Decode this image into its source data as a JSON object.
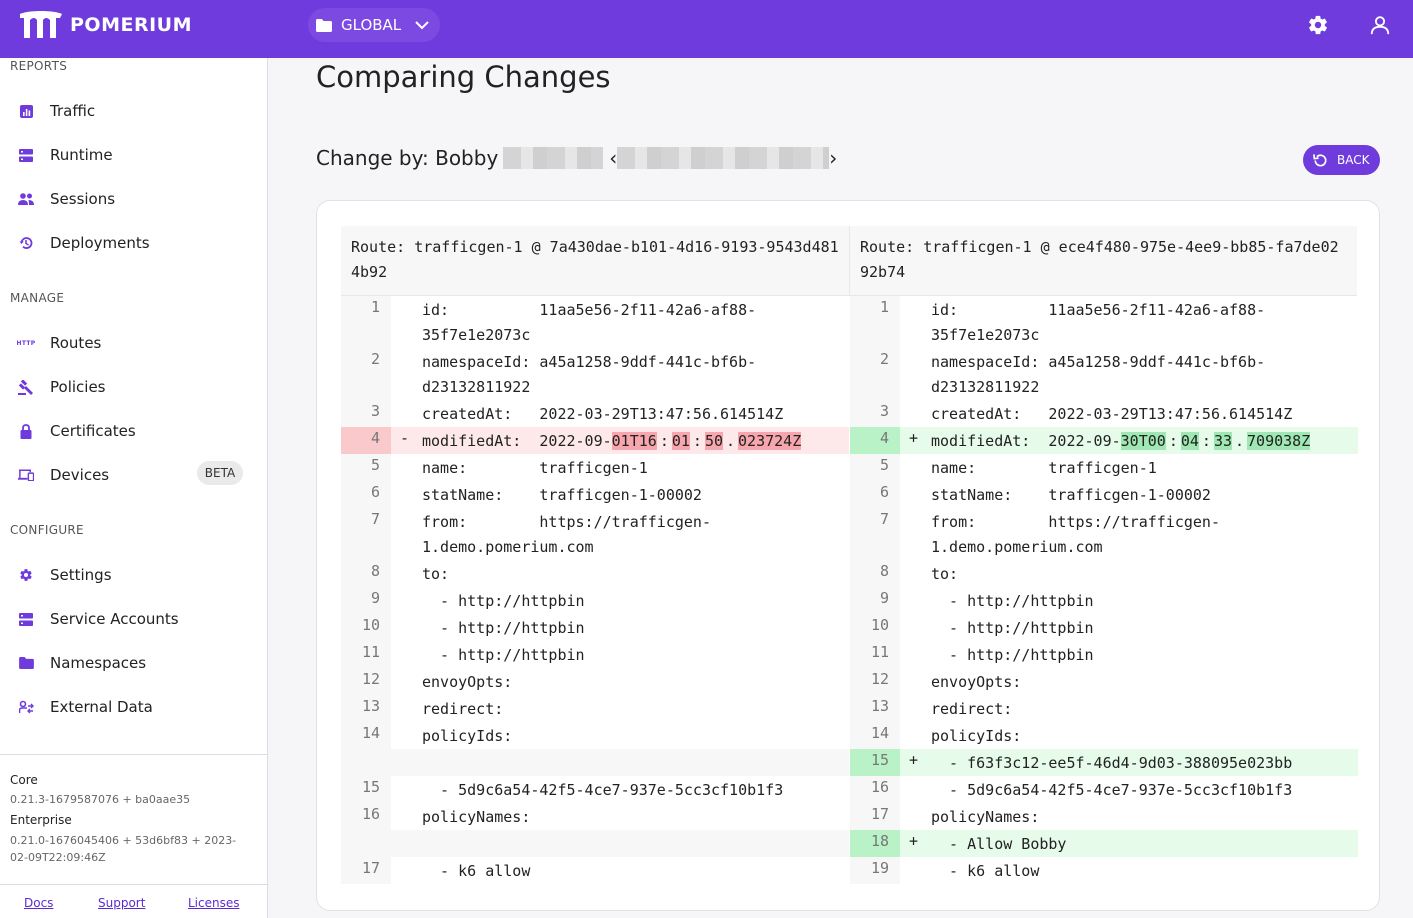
{
  "brand": {
    "name": "POMERIUM"
  },
  "header": {
    "namespace": "GLOBAL"
  },
  "sidebar": {
    "sections": [
      {
        "title": "REPORTS",
        "items": [
          {
            "label": "Traffic",
            "icon": "bar-chart-icon"
          },
          {
            "label": "Runtime",
            "icon": "storage-icon"
          },
          {
            "label": "Sessions",
            "icon": "people-icon"
          },
          {
            "label": "Deployments",
            "icon": "history-icon"
          }
        ]
      },
      {
        "title": "MANAGE",
        "items": [
          {
            "label": "Routes",
            "icon": "http-icon"
          },
          {
            "label": "Policies",
            "icon": "gavel-icon"
          },
          {
            "label": "Certificates",
            "icon": "lock-icon"
          },
          {
            "label": "Devices",
            "icon": "devices-icon",
            "badge": "BETA"
          }
        ]
      },
      {
        "title": "CONFIGURE",
        "items": [
          {
            "label": "Settings",
            "icon": "gear-icon"
          },
          {
            "label": "Service Accounts",
            "icon": "storage-icon"
          },
          {
            "label": "Namespaces",
            "icon": "folder-icon"
          },
          {
            "label": "External Data",
            "icon": "external-data-icon"
          }
        ]
      }
    ],
    "version": {
      "core_label": "Core",
      "core_value": "0.21.3-1679587076 + ba0aae35",
      "enterprise_label": "Enterprise",
      "enterprise_value": "0.21.0-1676045406 + 53d6bf83 + 2023-02-09T22:09:46Z"
    },
    "footer": {
      "docs": "Docs",
      "support": "Support",
      "licenses": "Licenses"
    }
  },
  "main": {
    "title": "Comparing Changes",
    "change_by": "Change by: Bobby",
    "back_label": "BACK",
    "left_header": "Route: trafficgen-1 @ 7a430dae-b101-4d16-9193-9543d4814b92",
    "right_header": "Route: trafficgen-1 @ ece4f480-975e-4ee9-bb85-fa7de0292b74",
    "left_lines": [
      {
        "n": "1",
        "text": "id:          11aa5e56-2f11-42a6-af88-\n35f7e1e2073c"
      },
      {
        "n": "2",
        "text": "namespaceId: a45a1258-9ddf-441c-bf6b-\nd23132811922"
      },
      {
        "n": "3",
        "text": "createdAt:   2022-03-29T13:47:56.614514Z"
      },
      {
        "n": "4",
        "type": "del",
        "mark": "-",
        "pre": "modifiedAt:  2022-09-",
        "parts": [
          "01T16",
          ":",
          "01",
          ":",
          "50",
          ".",
          "023724Z"
        ]
      },
      {
        "n": "5",
        "text": "name:        trafficgen-1"
      },
      {
        "n": "6",
        "text": "statName:    trafficgen-1-00002"
      },
      {
        "n": "7",
        "text": "from:        https://trafficgen-\n1.demo.pomerium.com"
      },
      {
        "n": "8",
        "text": "to:"
      },
      {
        "n": "9",
        "text": "  - http://httpbin"
      },
      {
        "n": "10",
        "text": "  - http://httpbin"
      },
      {
        "n": "11",
        "text": "  - http://httpbin"
      },
      {
        "n": "12",
        "text": "envoyOpts:"
      },
      {
        "n": "13",
        "text": "redirect:"
      },
      {
        "n": "14",
        "text": "policyIds:"
      },
      {
        "n": "",
        "type": "empty",
        "text": ""
      },
      {
        "n": "15",
        "text": "  - 5d9c6a54-42f5-4ce7-937e-5cc3cf10b1f3"
      },
      {
        "n": "16",
        "text": "policyNames:"
      },
      {
        "n": "",
        "type": "empty",
        "text": ""
      },
      {
        "n": "17",
        "text": "  - k6 allow"
      }
    ],
    "right_lines": [
      {
        "n": "1",
        "text": "id:          11aa5e56-2f11-42a6-af88-\n35f7e1e2073c"
      },
      {
        "n": "2",
        "text": "namespaceId: a45a1258-9ddf-441c-bf6b-\nd23132811922"
      },
      {
        "n": "3",
        "text": "createdAt:   2022-03-29T13:47:56.614514Z"
      },
      {
        "n": "4",
        "type": "add",
        "mark": "+",
        "pre": "modifiedAt:  2022-09-",
        "parts": [
          "30T00",
          ":",
          "04",
          ":",
          "33",
          ".",
          "709038Z"
        ]
      },
      {
        "n": "5",
        "text": "name:        trafficgen-1"
      },
      {
        "n": "6",
        "text": "statName:    trafficgen-1-00002"
      },
      {
        "n": "7",
        "text": "from:        https://trafficgen-\n1.demo.pomerium.com"
      },
      {
        "n": "8",
        "text": "to:"
      },
      {
        "n": "9",
        "text": "  - http://httpbin"
      },
      {
        "n": "10",
        "text": "  - http://httpbin"
      },
      {
        "n": "11",
        "text": "  - http://httpbin"
      },
      {
        "n": "12",
        "text": "envoyOpts:"
      },
      {
        "n": "13",
        "text": "redirect:"
      },
      {
        "n": "14",
        "text": "policyIds:"
      },
      {
        "n": "15",
        "type": "add",
        "mark": "+",
        "text": "  - f63f3c12-ee5f-46d4-9d03-388095e023bb"
      },
      {
        "n": "16",
        "text": "  - 5d9c6a54-42f5-4ce7-937e-5cc3cf10b1f3"
      },
      {
        "n": "17",
        "text": "policyNames:"
      },
      {
        "n": "18",
        "type": "add",
        "mark": "+",
        "text": "  - Allow Bobby"
      },
      {
        "n": "19",
        "text": "  - k6 allow"
      }
    ]
  }
}
